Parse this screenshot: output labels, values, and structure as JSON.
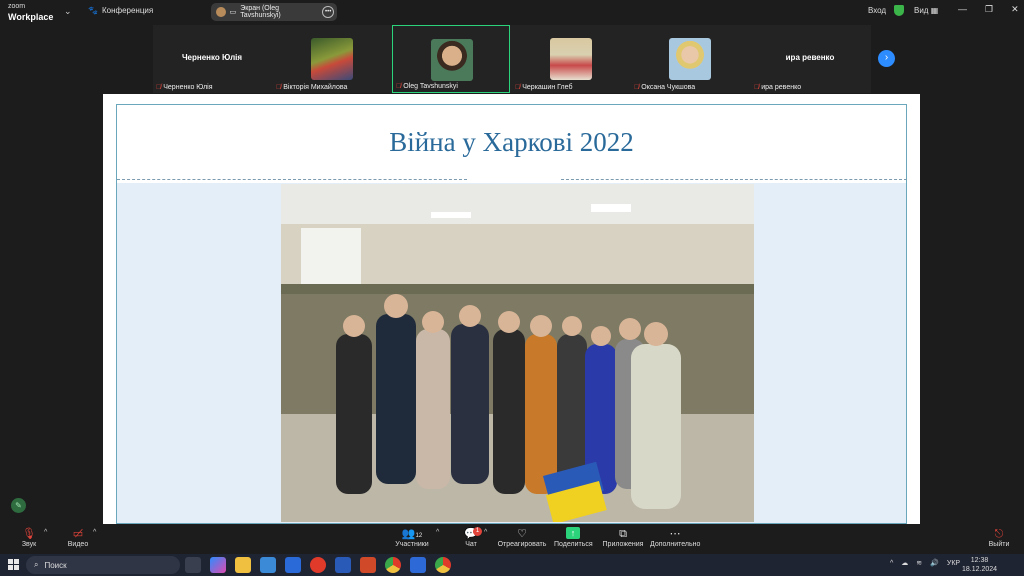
{
  "titlebar": {
    "brand_top": "zoom",
    "brand_bottom": "Workplace",
    "conference_label": "Конференция",
    "share_label": "Экран (Oleg Tavshunskyi)",
    "login_label": "Вход",
    "view_label": "Вид"
  },
  "gallery": {
    "tiles": [
      {
        "name": "Черненко Юлія",
        "big_name": "Черненко Юлія",
        "photo_color": ""
      },
      {
        "name": "Вікторія Михайлова",
        "big_name": "",
        "photo_color": "#6a7a3a"
      },
      {
        "name": "Oleg Tavshunskyi",
        "big_name": "",
        "photo_color": "#4a7a5a"
      },
      {
        "name": "Черкашин Глеб",
        "big_name": "",
        "photo_color": "#b5a78a"
      },
      {
        "name": "Оксана Чукшова",
        "big_name": "",
        "photo_color": "#c9b47a"
      },
      {
        "name": "ира ревенко",
        "big_name": "ира ревенко",
        "photo_color": ""
      }
    ]
  },
  "slide": {
    "title": "Війна у Харкові 2022"
  },
  "toolbar": {
    "audio": "Звук",
    "video": "Видео",
    "participants": "Участники",
    "participants_count": "12",
    "chat": "Чат",
    "chat_badge": "1",
    "react": "Отреагировать",
    "share": "Поделиться",
    "apps": "Приложения",
    "more": "Дополнительно",
    "exit": "Выйти"
  },
  "taskbar": {
    "search_placeholder": "Поиск",
    "lang": "УКР",
    "time": "12:38",
    "date": "18.12.2024"
  },
  "colors": {
    "accent_green": "#2bd37a",
    "accent_blue": "#2d8cff",
    "mic_off_red": "#e0443a",
    "title_blue": "#2a6a9a"
  }
}
